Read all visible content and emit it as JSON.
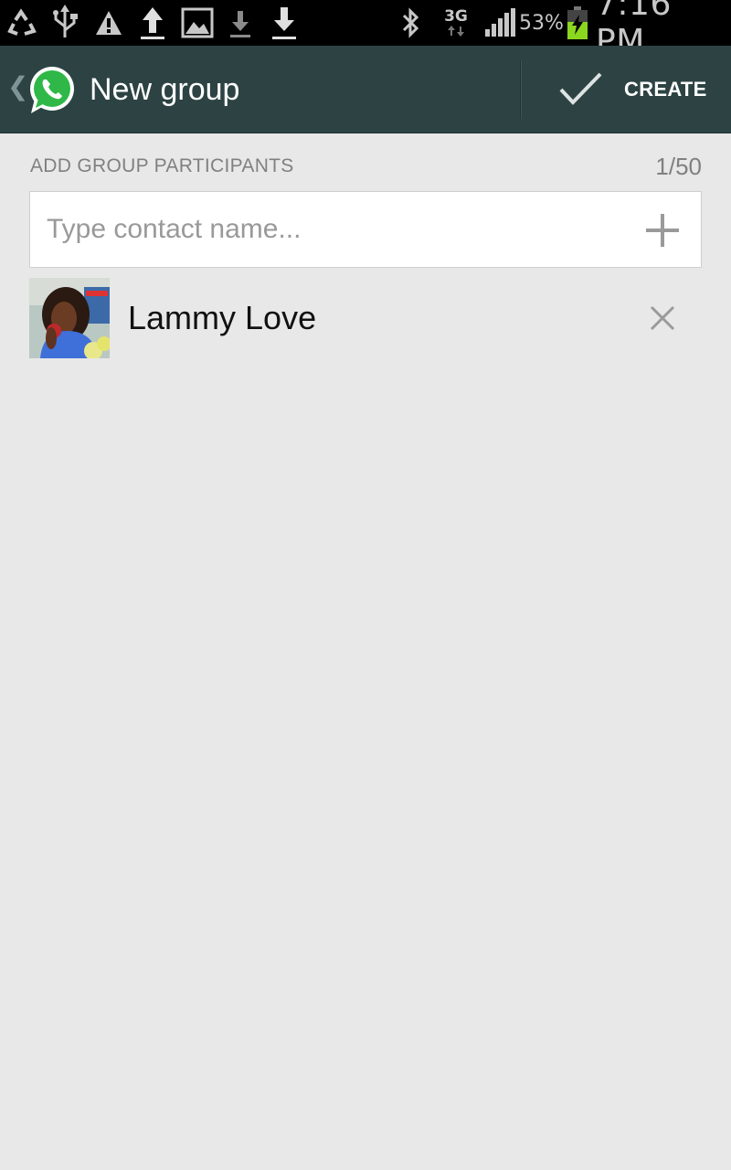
{
  "status_bar": {
    "icons": [
      "recycle-icon",
      "usb-icon",
      "warning-icon",
      "upload-icon",
      "image-icon",
      "download-icon",
      "download-icon",
      "bluetooth-icon",
      "3g-icon",
      "signal-icon",
      "battery-charging-icon"
    ],
    "network": "3G",
    "battery_percent": "53%",
    "time": "7:16 PM"
  },
  "action_bar": {
    "title": "New group",
    "create_label": "CREATE",
    "color": "#2d4343"
  },
  "participants_section": {
    "header": "ADD GROUP PARTICIPANTS",
    "count": "1/50",
    "search_placeholder": "Type contact name...",
    "search_value": ""
  },
  "participants": [
    {
      "name": "Lammy Love"
    }
  ],
  "colors": {
    "background": "#e8e8e8",
    "whatsapp_green": "#2fb847",
    "battery_green": "#8bd61f"
  }
}
